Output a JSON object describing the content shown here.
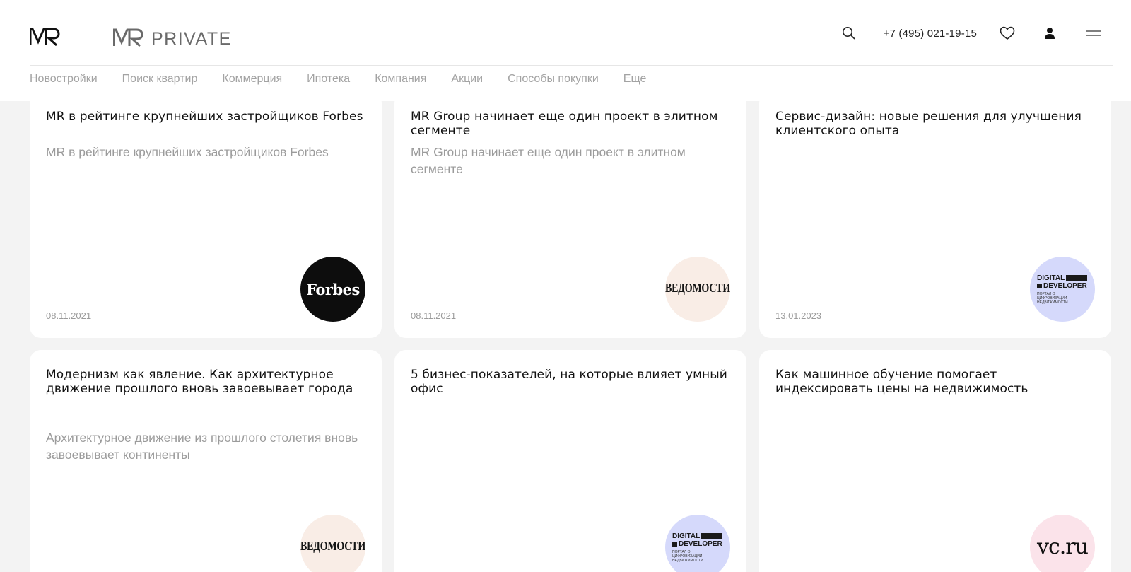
{
  "header": {
    "logo_label": "MR",
    "private_logo_text": "PRIVATE",
    "phone": "+7 (495) 021-19-15",
    "icons": [
      "search-icon",
      "heart-icon",
      "user-icon",
      "menu-icon"
    ]
  },
  "nav": [
    "Новостройки",
    "Поиск квартир",
    "Коммерция",
    "Ипотека",
    "Компания",
    "Акции",
    "Способы покупки",
    "Еще"
  ],
  "cards": [
    {
      "title": "MR в рейтинге крупнейших застройщиков Forbes",
      "subtitle": "MR в рейтинге крупнейших застройщиков Forbes",
      "date": "08.11.2021",
      "source": "Forbes"
    },
    {
      "title": "MR Group начинает еще один проект в элитном сегменте",
      "subtitle": "MR Group начинает еще один проект в элитном сегменте",
      "date": "08.11.2021",
      "source": "ВЕДОМОСТИ"
    },
    {
      "title": "Сервис-дизайн: новые решения для улучшения клиентского опыта",
      "subtitle": "",
      "date": "13.01.2023",
      "source": "DIGITAL DEVELOPER",
      "source_caption": "ПОРТАЛ О ЦИФРОВИЗАЦИИ НЕДВИЖИМОСТИ"
    },
    {
      "title": "Модернизм как явление. Как архитектурное движение прошлого вновь завоевывает города",
      "subtitle": "Архитектурное движение из прошлого столетия вновь завоевывает континенты",
      "date": "",
      "source": "ВЕДОМОСТИ"
    },
    {
      "title": "5 бизнес-показателей, на которые влияет умный офис",
      "subtitle": "",
      "date": "",
      "source": "DIGITAL DEVELOPER",
      "source_caption": "ПОРТАЛ О ЦИФРОВИЗАЦИИ НЕДВИЖИМОСТИ"
    },
    {
      "title": "Как машинное обучение помогает индексировать цены на недвижимость",
      "subtitle": "",
      "date": "",
      "source": "vc.ru"
    }
  ],
  "colors": {
    "page_bg": "#f3f3f3",
    "card_bg": "#ffffff",
    "nav_text": "#a3a3a3",
    "forbes_badge": "#0d0d0d",
    "vedomosti_badge": "#f9ede6",
    "digital_developer_badge": "#d5d9fb",
    "vc_badge": "#fbe3ea"
  }
}
